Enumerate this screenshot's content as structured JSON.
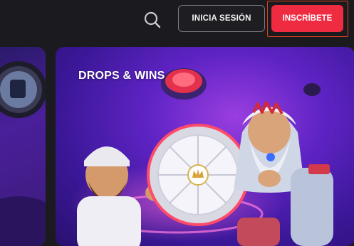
{
  "header": {
    "search_icon": "search-icon",
    "login_label": "INICIA SESIÓN",
    "signup_label": "INSCRÍBETE"
  },
  "promo": {
    "title": "DROPS & WINS"
  },
  "colors": {
    "background": "#1b1b1f",
    "signup_button": "#ef2b41",
    "signup_outline": "#e0401a",
    "banner_purple": "#5e23c4"
  }
}
